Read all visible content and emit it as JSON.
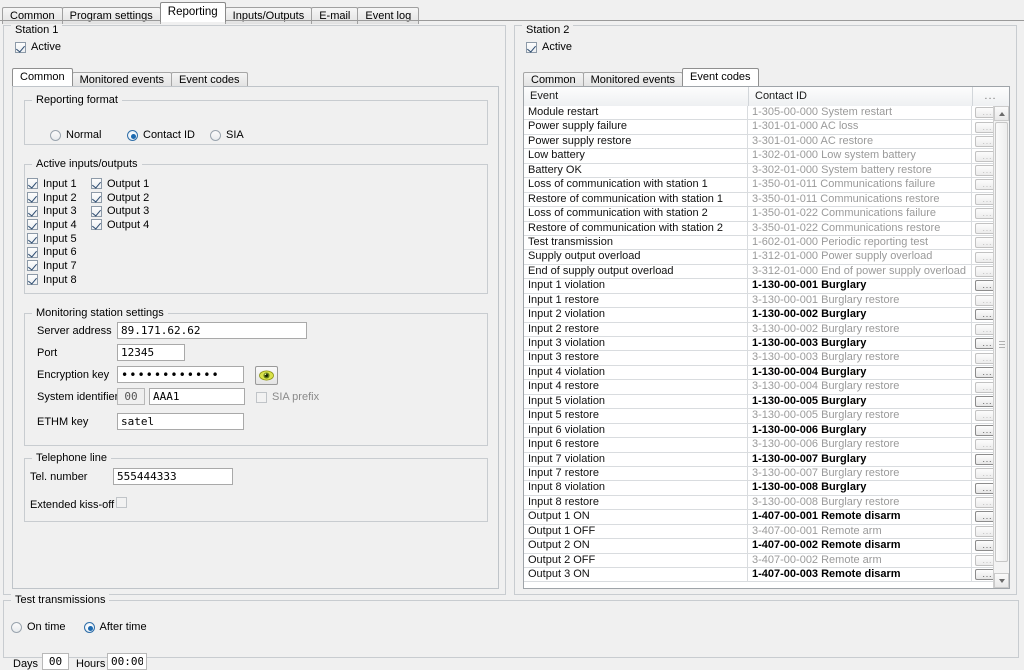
{
  "window": {
    "main_tabs": [
      {
        "label": "Common",
        "active": false
      },
      {
        "label": "Program settings",
        "active": false
      },
      {
        "label": "Reporting",
        "active": true
      },
      {
        "label": "Inputs/Outputs",
        "active": false
      },
      {
        "label": "E-mail",
        "active": false
      },
      {
        "label": "Event log",
        "active": false
      }
    ]
  },
  "station1": {
    "title": "Station 1",
    "active_label": "Active",
    "active_checked": true,
    "tabs": [
      {
        "label": "Common",
        "active": true
      },
      {
        "label": "Monitored events",
        "active": false
      },
      {
        "label": "Event codes",
        "active": false
      }
    ],
    "reporting_format": {
      "caption": "Reporting format",
      "options": [
        {
          "label": "Normal",
          "selected": false
        },
        {
          "label": "Contact ID",
          "selected": true
        },
        {
          "label": "SIA",
          "selected": false
        }
      ]
    },
    "active_io": {
      "caption": "Active inputs/outputs",
      "inputs": [
        {
          "label": "Input 1",
          "checked": true
        },
        {
          "label": "Input 2",
          "checked": true
        },
        {
          "label": "Input 3",
          "checked": true
        },
        {
          "label": "Input 4",
          "checked": true
        },
        {
          "label": "Input 5",
          "checked": true
        },
        {
          "label": "Input 6",
          "checked": true
        },
        {
          "label": "Input 7",
          "checked": true
        },
        {
          "label": "Input 8",
          "checked": true
        }
      ],
      "outputs": [
        {
          "label": "Output 1",
          "checked": true
        },
        {
          "label": "Output 2",
          "checked": true
        },
        {
          "label": "Output 3",
          "checked": true
        },
        {
          "label": "Output 4",
          "checked": true
        }
      ]
    },
    "monitoring": {
      "caption": "Monitoring station settings",
      "server_address_label": "Server address",
      "server_address_value": "89.171.62.62",
      "port_label": "Port",
      "port_value": "12345",
      "encryption_key_label": "Encryption key",
      "encryption_key_value": "••••••••••••",
      "show_key_icon": "eye-icon",
      "system_identifier_label": "System identifier",
      "system_identifier_prefix": "00",
      "system_identifier_value": "AAA1",
      "sia_prefix_label": "SIA prefix",
      "sia_prefix_checked": false,
      "ethm_key_label": "ETHM key",
      "ethm_key_value": "satel"
    },
    "telephone": {
      "caption": "Telephone line",
      "tel_number_label": "Tel. number",
      "tel_number_value": "555444333",
      "extended_kissoff_label": "Extended kiss-off",
      "extended_kissoff_checked": false
    }
  },
  "station2": {
    "title": "Station 2",
    "active_label": "Active",
    "active_checked": true,
    "tabs": [
      {
        "label": "Common",
        "active": false
      },
      {
        "label": "Monitored events",
        "active": false
      },
      {
        "label": "Event codes",
        "active": true
      }
    ],
    "table": {
      "columns": [
        "Event",
        "Contact ID",
        "..."
      ],
      "rows": [
        {
          "event": "Module restart",
          "code": "1-305-00-000 System restart",
          "bold": false
        },
        {
          "event": "Power supply failure",
          "code": "1-301-01-000 AC loss",
          "bold": false
        },
        {
          "event": "Power supply restore",
          "code": "3-301-01-000 AC restore",
          "bold": false
        },
        {
          "event": "Low battery",
          "code": "1-302-01-000 Low system battery",
          "bold": false
        },
        {
          "event": "Battery OK",
          "code": "3-302-01-000 System battery restore",
          "bold": false
        },
        {
          "event": "Loss of communication with station 1",
          "code": "1-350-01-011 Communications failure",
          "bold": false
        },
        {
          "event": "Restore of communication with station 1",
          "code": "3-350-01-011 Communications restore",
          "bold": false
        },
        {
          "event": "Loss of communication with station 2",
          "code": "1-350-01-022 Communications failure",
          "bold": false
        },
        {
          "event": "Restore of communication with station 2",
          "code": "3-350-01-022 Communications restore",
          "bold": false
        },
        {
          "event": "Test transmission",
          "code": "1-602-01-000 Periodic reporting test",
          "bold": false
        },
        {
          "event": "Supply output overload",
          "code": "1-312-01-000 Power supply overload",
          "bold": false
        },
        {
          "event": "End of supply output overload",
          "code": "3-312-01-000 End of power supply overload",
          "bold": false
        },
        {
          "event": "Input 1 violation",
          "code": "1-130-00-001 Burglary",
          "bold": true
        },
        {
          "event": "Input 1 restore",
          "code": "3-130-00-001 Burglary restore",
          "bold": false
        },
        {
          "event": "Input 2 violation",
          "code": "1-130-00-002 Burglary",
          "bold": true
        },
        {
          "event": "Input 2 restore",
          "code": "3-130-00-002 Burglary restore",
          "bold": false
        },
        {
          "event": "Input 3 violation",
          "code": "1-130-00-003 Burglary",
          "bold": true
        },
        {
          "event": "Input 3 restore",
          "code": "3-130-00-003 Burglary restore",
          "bold": false
        },
        {
          "event": "Input 4 violation",
          "code": "1-130-00-004 Burglary",
          "bold": true
        },
        {
          "event": "Input 4 restore",
          "code": "3-130-00-004 Burglary restore",
          "bold": false
        },
        {
          "event": "Input 5 violation",
          "code": "1-130-00-005 Burglary",
          "bold": true
        },
        {
          "event": "Input 5 restore",
          "code": "3-130-00-005 Burglary restore",
          "bold": false
        },
        {
          "event": "Input 6 violation",
          "code": "1-130-00-006 Burglary",
          "bold": true
        },
        {
          "event": "Input 6 restore",
          "code": "3-130-00-006 Burglary restore",
          "bold": false
        },
        {
          "event": "Input 7 violation",
          "code": "1-130-00-007 Burglary",
          "bold": true
        },
        {
          "event": "Input 7 restore",
          "code": "3-130-00-007 Burglary restore",
          "bold": false
        },
        {
          "event": "Input 8 violation",
          "code": "1-130-00-008 Burglary",
          "bold": true
        },
        {
          "event": "Input 8 restore",
          "code": "3-130-00-008 Burglary restore",
          "bold": false
        },
        {
          "event": "Output 1 ON",
          "code": "1-407-00-001 Remote disarm",
          "bold": true
        },
        {
          "event": "Output 1 OFF",
          "code": "3-407-00-001 Remote arm",
          "bold": false
        },
        {
          "event": "Output 2 ON",
          "code": "1-407-00-002 Remote disarm",
          "bold": true
        },
        {
          "event": "Output 2 OFF",
          "code": "3-407-00-002 Remote arm",
          "bold": false
        },
        {
          "event": "Output 3 ON",
          "code": "1-407-00-003 Remote disarm",
          "bold": true
        }
      ]
    }
  },
  "test_transmissions": {
    "caption": "Test transmissions",
    "options": [
      {
        "label": "On time",
        "selected": false
      },
      {
        "label": "After time",
        "selected": true
      }
    ],
    "days_label": "Days",
    "days_value": "00",
    "hours_label": "Hours",
    "hours_value": "00:00"
  }
}
